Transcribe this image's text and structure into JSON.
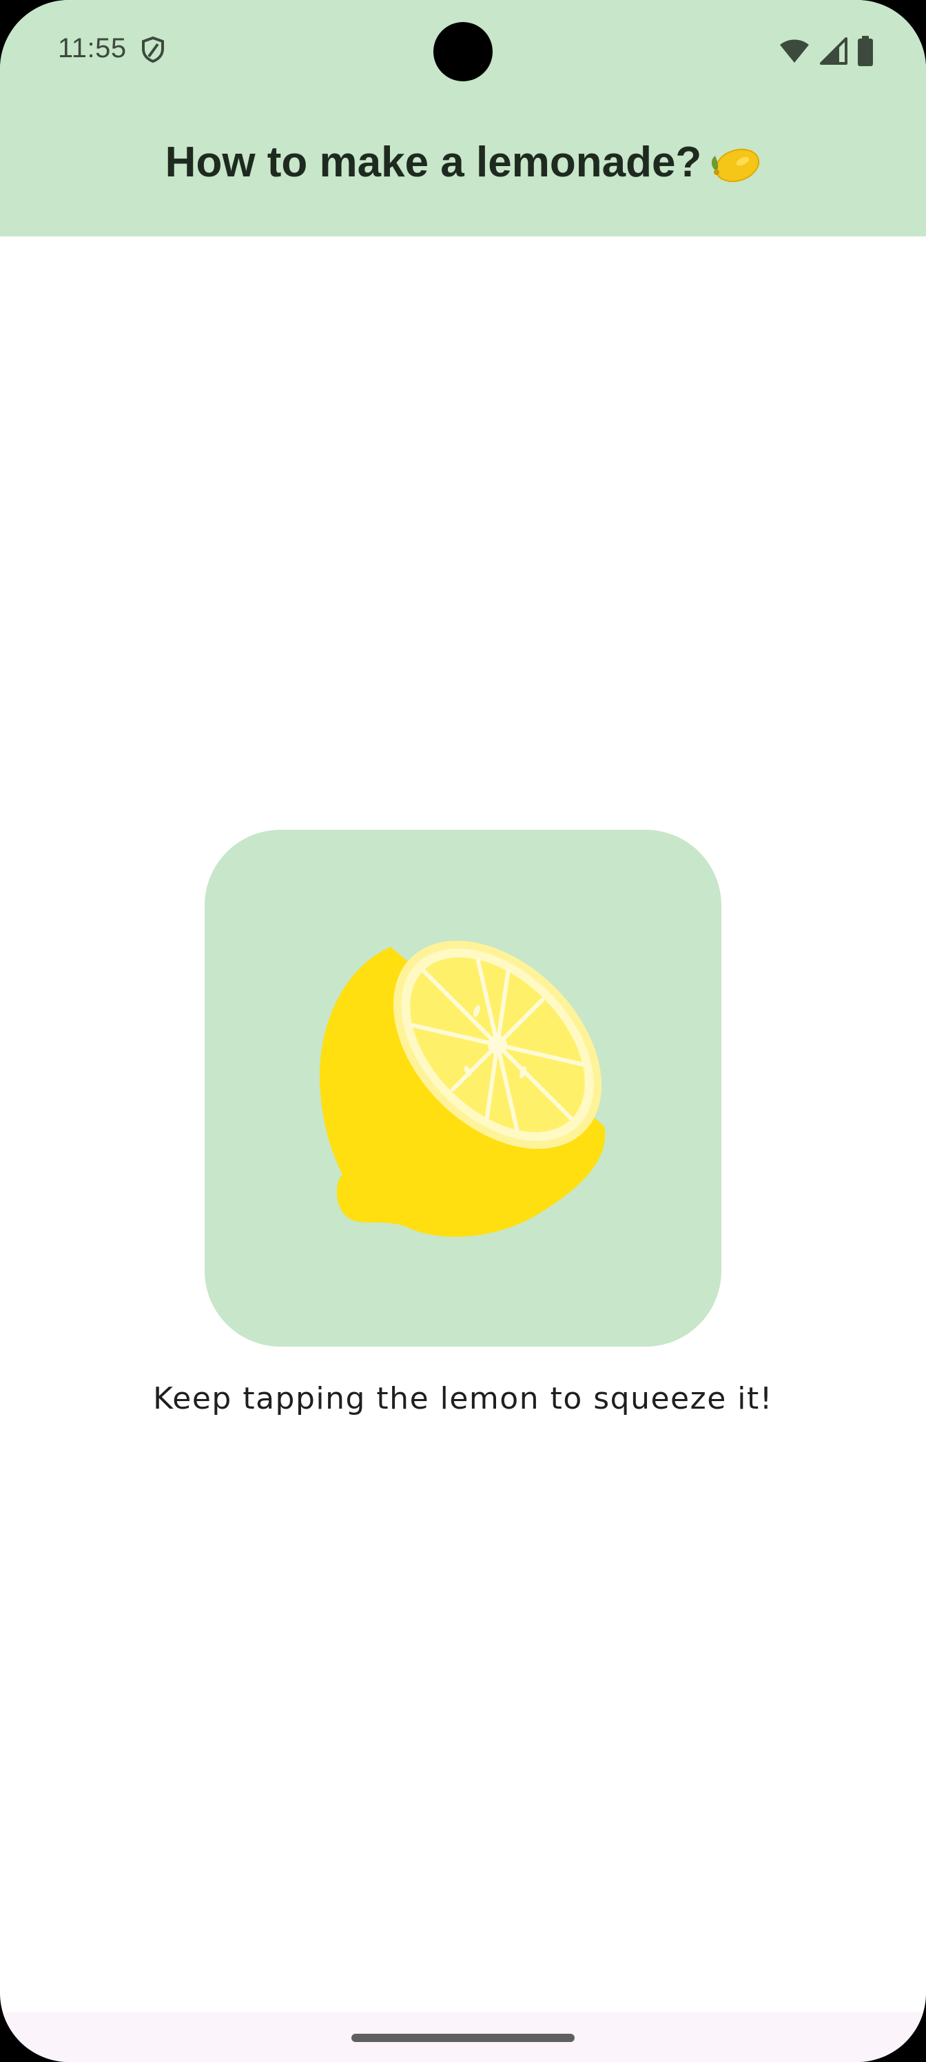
{
  "status_bar": {
    "time": "11:55"
  },
  "app_bar": {
    "title": "How to make a lemonade?",
    "title_emoji_icon": "lemon-icon",
    "background_color": "#c8e6c9"
  },
  "main": {
    "image_button_icon": "lemon-half-icon",
    "image_button_background": "#c8e6c9",
    "instruction_text": "Keep tapping the lemon to squeeze it!"
  },
  "colors": {
    "lemon_yellow": "#ffdf10",
    "lemon_flesh": "#fff06a",
    "lemon_rind_light": "#fff7a8",
    "leaf_green": "#6f9a2e"
  }
}
